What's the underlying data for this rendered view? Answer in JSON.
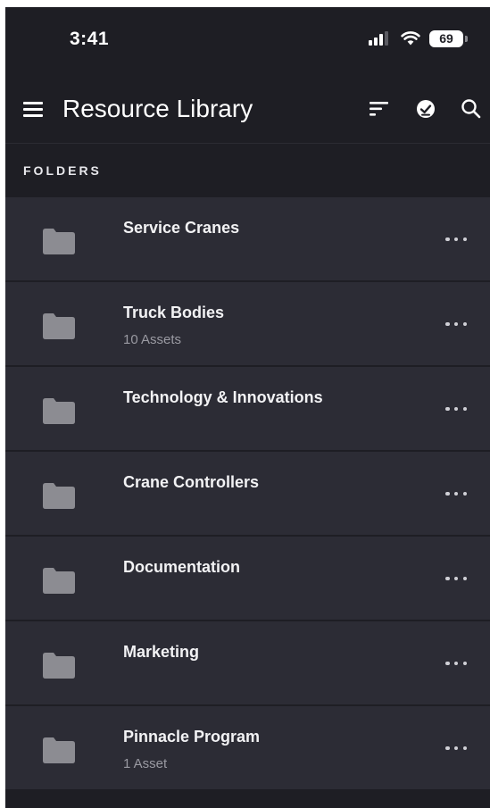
{
  "status_bar": {
    "time": "3:41",
    "battery": "69",
    "icons": [
      "signal-icon",
      "wifi-icon",
      "battery-icon"
    ]
  },
  "header": {
    "title": "Resource Library",
    "icons": [
      "menu-icon",
      "sort-icon",
      "check-circle-icon",
      "search-icon"
    ]
  },
  "section": {
    "label": "FOLDERS"
  },
  "folders": [
    {
      "name": "Service Cranes",
      "count": ""
    },
    {
      "name": "Truck Bodies",
      "count": "10 Assets"
    },
    {
      "name": "Technology & Innovations",
      "count": ""
    },
    {
      "name": "Crane Controllers",
      "count": ""
    },
    {
      "name": "Documentation",
      "count": ""
    },
    {
      "name": "Marketing",
      "count": ""
    },
    {
      "name": "Pinnacle Program",
      "count": "1 Asset"
    }
  ],
  "colors": {
    "background": "#1e1e24",
    "row": "#2c2c35",
    "folder_icon": "#8c8c92",
    "text_primary": "#f2f2f4",
    "text_secondary": "#9a9aa2"
  }
}
